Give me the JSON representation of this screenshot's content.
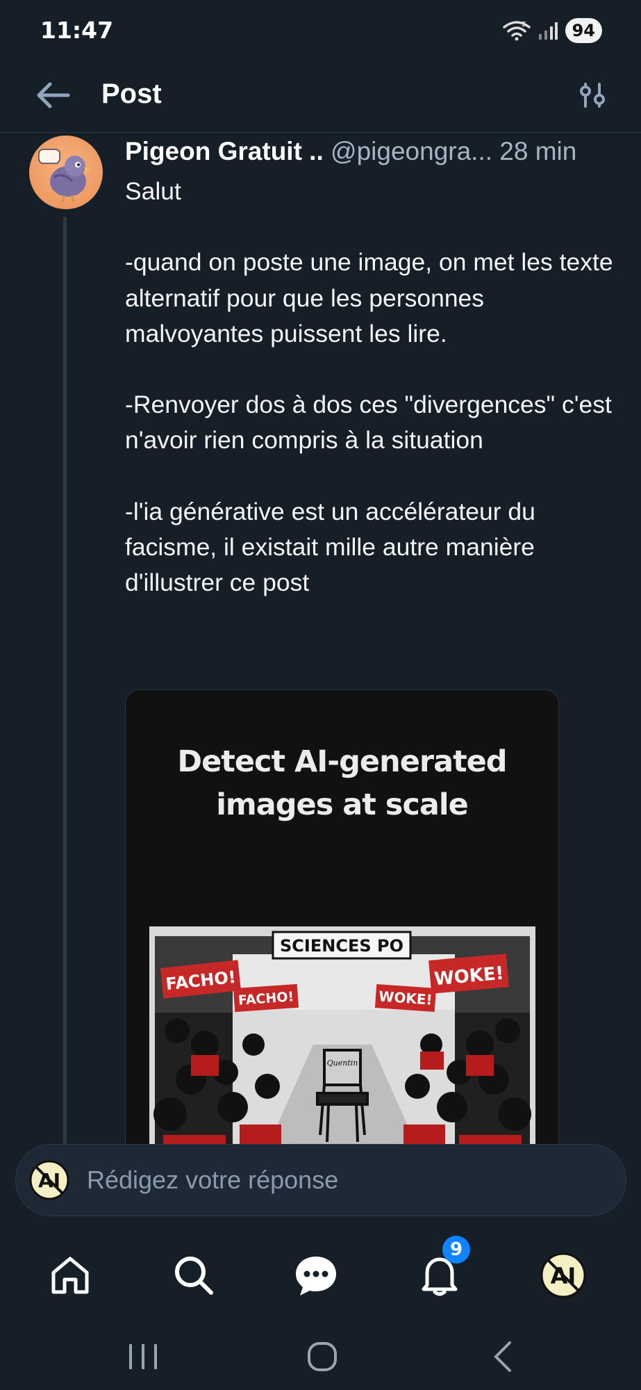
{
  "status_bar": {
    "time": "11:47",
    "battery": "94"
  },
  "header": {
    "title": "Post"
  },
  "post": {
    "author_name": "Pigeon Gratuit ..",
    "author_handle": "@pigeongra...",
    "time": "28 min",
    "body": [
      "Salut",
      "-quand on poste une image, on met les texte alternatif pour que les personnes malvoyantes puissent les lire.",
      "-Renvoyer dos à dos ces \"divergences\" c'est n'avoir rien compris à la situation",
      "-l'ia générative est un accélérateur du facisme, il existait mille autre manière d'illustrer ce post"
    ],
    "image": {
      "headline_line1": "Detect AI-generated",
      "headline_line2": "images at scale",
      "sign": "SCIENCES PO",
      "banners": [
        "FACHO!",
        "FACHO!",
        "WOKE!",
        "WOKE!"
      ],
      "chair_label": "Quentin"
    }
  },
  "reply": {
    "placeholder": "Rédigez votre réponse"
  },
  "nav": {
    "notifications_badge": "9"
  },
  "colors": {
    "background": "#161e27",
    "accent": "#1083fe",
    "muted_text": "#a7b5c4",
    "avatar_bg": "#ee9a62"
  }
}
